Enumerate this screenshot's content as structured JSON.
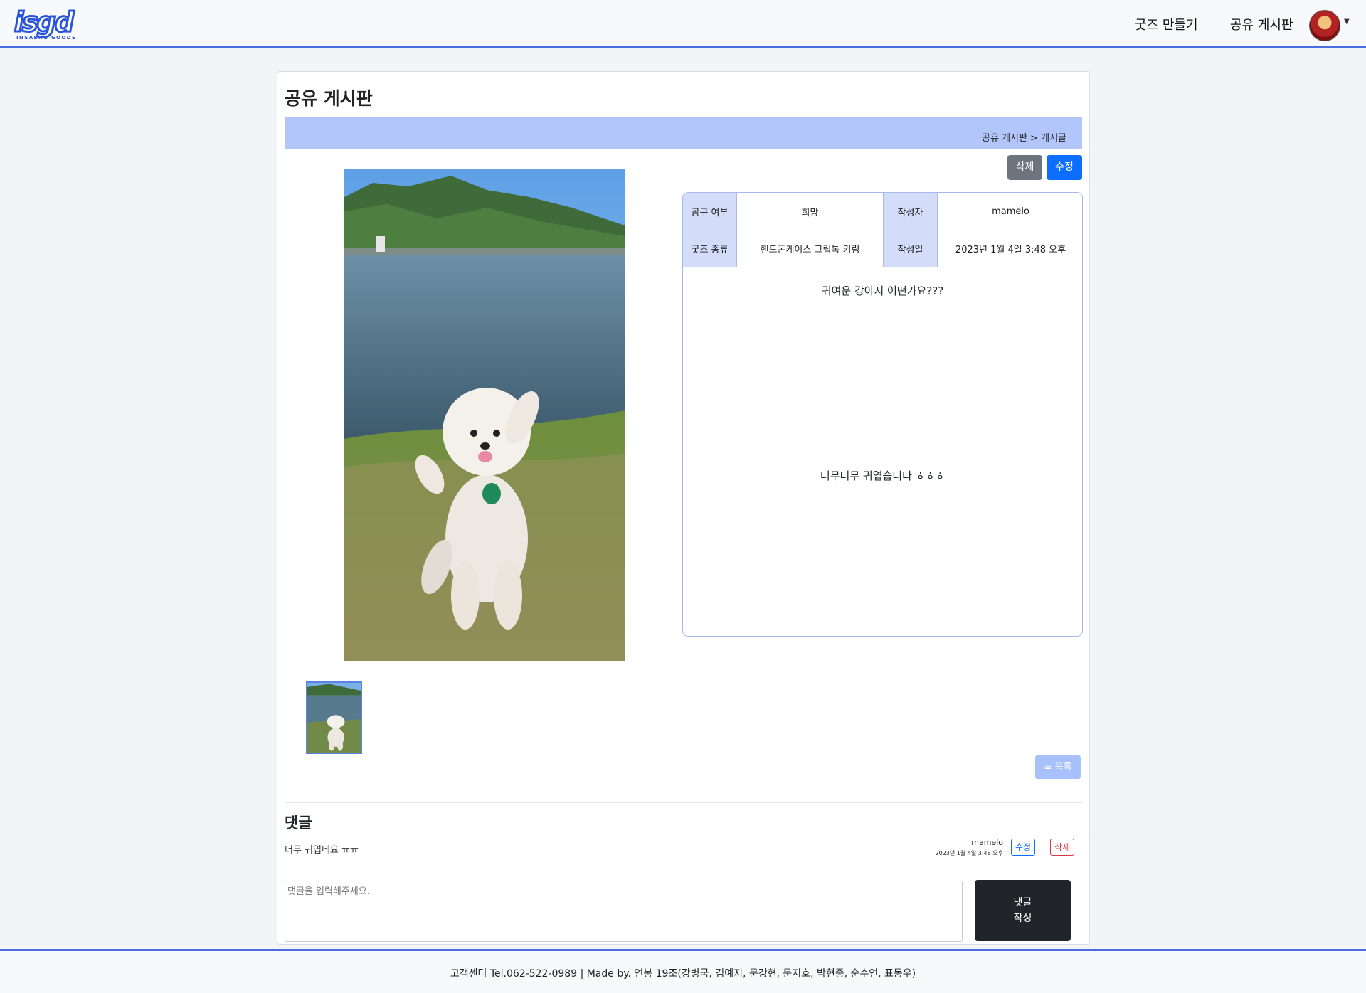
{
  "header": {
    "logo_text": "isgd",
    "logo_sub": "INSAENG GOODS",
    "nav": [
      "굿즈 만들기",
      "공유 게시판"
    ]
  },
  "page": {
    "title": "공유 게시판",
    "breadcrumb": "공유 게시판 > 게시글",
    "delete_label": "삭제",
    "edit_label": "수정"
  },
  "post": {
    "labels": {
      "group_buy": "공구 여부",
      "author": "작성자",
      "goods_type": "굿즈 종류",
      "date": "작성일"
    },
    "group_buy": "희망",
    "author": "mamelo",
    "goods_type": "핸드폰케이스 그립톡 키링",
    "date": "2023년 1월 4일 3:48 오후",
    "title": "귀여운 강아지 어떤가요???",
    "content": "너무너무 귀엽습니다 ㅎㅎㅎ",
    "list_label": "≡ 목록"
  },
  "comments": {
    "title": "댓글",
    "items": [
      {
        "text": "너무 귀엽네요 ㅠㅠ",
        "author": "mamelo",
        "date": "2023년 1월 4일 3:48 오후",
        "edit_label": "수정",
        "delete_label": "삭제"
      }
    ],
    "input_placeholder": "댓글을 입력해주세요.",
    "submit_line1": "댓글",
    "submit_line2": "작성"
  },
  "footer": {
    "text": "고객센터 Tel.062-522-0989 | Made by. 연봉 19조(강병국, 김예지, 문강현, 문지호, 박현종, 순수연, 표동우)"
  },
  "colors": {
    "accent": "#4a6ee0",
    "breadcrumb_bg": "#b3c6fb",
    "table_head_bg": "#d3ddfa",
    "primary": "#0d6efd",
    "secondary": "#6c757d",
    "danger": "#dc3545",
    "dark": "#212529"
  }
}
